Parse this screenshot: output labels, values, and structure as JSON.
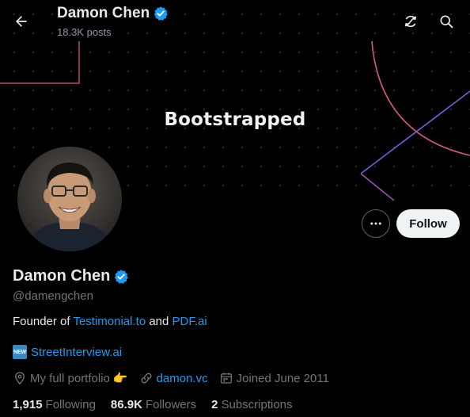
{
  "header": {
    "name": "Damon Chen",
    "posts": "18.3K posts"
  },
  "banner": {
    "text": "Bootstrapped"
  },
  "actions": {
    "more_label": "•••",
    "follow_label": "Follow"
  },
  "profile": {
    "name": "Damon Chen",
    "handle": "@damengchen",
    "bio_prefix": "Founder of ",
    "bio_link1": "Testimonial.to",
    "bio_middle": " and ",
    "bio_link2": "PDF.ai",
    "new_badge": "NEW",
    "link_text": "StreetInterview.ai",
    "location": "My full portfolio",
    "location_emoji": "👉",
    "website": "damon.vc",
    "joined": "Joined June 2011"
  },
  "stats": {
    "following_count": "1,915",
    "following_label": "Following",
    "followers_count": "86.9K",
    "followers_label": "Followers",
    "subscriptions_count": "2",
    "subscriptions_label": "Subscriptions"
  },
  "colors": {
    "accent": "#1d9bf0",
    "background": "#000000",
    "text": "#e7e9ea",
    "secondary_text": "#71767b"
  },
  "icons": {
    "back": "arrow-left-icon",
    "refresh": "refresh-off-icon",
    "search": "search-icon",
    "verified": "verified-badge-icon",
    "location": "location-pin-icon",
    "website": "link-icon",
    "joined": "calendar-icon"
  }
}
